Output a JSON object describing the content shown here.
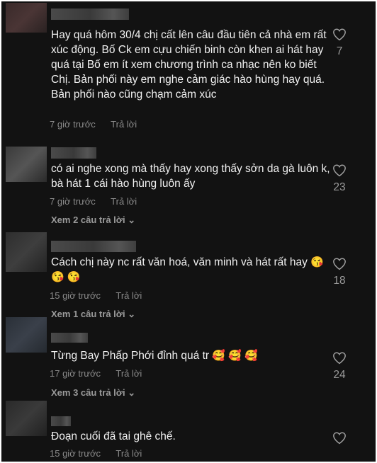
{
  "comments": [
    {
      "text": "Hay quá hôm 30/4 chị cất lên câu đầu tiên cả nhà em rất xúc động. Bố Ck em cựu chiến binh còn khen ai hát hay quá tại Bố em ít xem chương trình ca nhạc nên ko biết Chị. Bản phối này em nghe cảm giác hào hùng hay quá. Bản phối nào cũng chạm cảm xúc",
      "time": "7 giờ trước",
      "reply": "Trả lời",
      "likes": "7",
      "view_replies": ""
    },
    {
      "text": "có ai nghe xong mà thấy hay xong thấy sởn da gà luôn k, bà hát 1 cái hào hùng luôn ấy",
      "time": "7 giờ trước",
      "reply": "Trả lời",
      "likes": "23",
      "view_replies": "Xem 2 câu trả lời"
    },
    {
      "text": "Cách chị này nc rất văn hoá, văn minh và hát rất hay",
      "emojis": "😘 😘 😘",
      "time": "15 giờ trước",
      "reply": "Trả lời",
      "likes": "18",
      "view_replies": "Xem 1 câu trả lời"
    },
    {
      "text": "Từng Bay Phấp Phới đỉnh quá tr",
      "emojis": "🥰 🥰 🥰",
      "time": "17 giờ trước",
      "reply": "Trả lời",
      "likes": "24",
      "view_replies": "Xem 3 câu trả lời"
    },
    {
      "text": "Đoạn cuối đã tai ghê chế.",
      "time": "15 giờ trước",
      "reply": "Trả lời",
      "likes": "",
      "view_replies": ""
    }
  ],
  "icons": {
    "like": "heart-outline-icon",
    "expand": "chevron-down-icon"
  },
  "colors": {
    "background": "#121212",
    "text": "#f1f1f1",
    "muted": "#8a8a8a",
    "frame": "#111111"
  }
}
